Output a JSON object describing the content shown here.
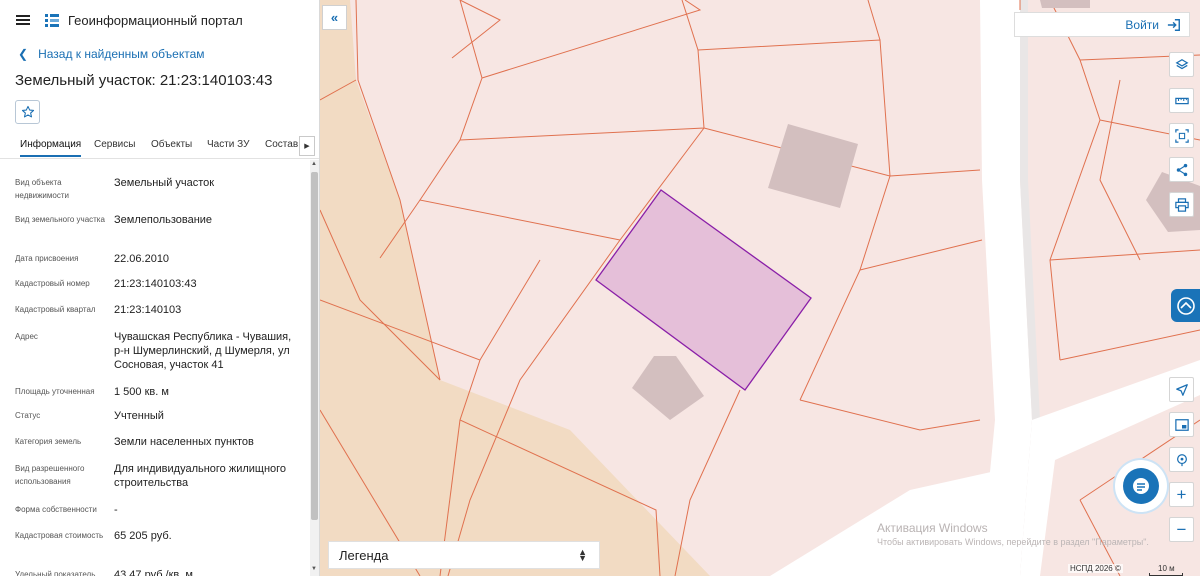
{
  "header": {
    "title": "Геоинформационный портал"
  },
  "nav": {
    "back_label": "Назад к найденным объектам"
  },
  "object": {
    "title": "Земельный участок: 21:23:140103:43"
  },
  "tabs": [
    {
      "label": "Информация"
    },
    {
      "label": "Сервисы"
    },
    {
      "label": "Объекты"
    },
    {
      "label": "Части ЗУ"
    },
    {
      "label": "Состав"
    }
  ],
  "properties": [
    {
      "label": "Вид объекта недвижимости",
      "value": "Земельный участок"
    },
    {
      "label": "Вид земельного участка",
      "value": "Землепользование"
    },
    {
      "label": "Дата присвоения",
      "value": "22.06.2010"
    },
    {
      "label": "Кадастровый номер",
      "value": "21:23:140103:43"
    },
    {
      "label": "Кадастровый квартал",
      "value": "21:23:140103"
    },
    {
      "label": "Адрес",
      "value": "Чувашская Республика - Чувашия, р-н Шумерлинский, д Шумерля, ул Сосновая, участок 41"
    },
    {
      "label": "Площадь уточненная",
      "value": "1 500 кв. м"
    },
    {
      "label": "Статус",
      "value": "Учтенный"
    },
    {
      "label": "Категория земель",
      "value": "Земли населенных пунктов"
    },
    {
      "label": "Вид разрешенного использования",
      "value": "Для индивидуального жилищного строительства"
    },
    {
      "label": "Форма собственности",
      "value": "-"
    },
    {
      "label": "Кадастровая стоимость",
      "value": "65 205 руб."
    },
    {
      "label": "Удельный показатель",
      "value": "43,47 руб./кв. м"
    }
  ],
  "auth": {
    "login_label": "Войти"
  },
  "legend": {
    "label": "Легенда"
  },
  "watermark": {
    "title": "Активация Windows",
    "text": "Чтобы активировать Windows, перейдите в раздел \"Параметры\"."
  },
  "footer": {
    "copyright": "НСПД 2026 ©",
    "scale": "10 м"
  },
  "colors": {
    "accent": "#1a73b8",
    "parcel_fill": "#e5bfd9",
    "parcel_stroke": "#8a1fa8",
    "boundary": "#e0714f",
    "forest": "#f3dcc4",
    "building": "#d2bcbc"
  },
  "icons": [
    "menu-icon",
    "portal-logo-icon",
    "chevron-left-icon",
    "star-icon",
    "chevron-right-icon",
    "double-chevron-left-icon",
    "login-icon",
    "layers-icon",
    "ruler-icon",
    "area-select-icon",
    "share-icon",
    "print-icon",
    "geolocation-icon",
    "minimap-icon",
    "location-pin-icon",
    "zoom-in-icon",
    "zoom-out-icon",
    "chat-icon"
  ]
}
